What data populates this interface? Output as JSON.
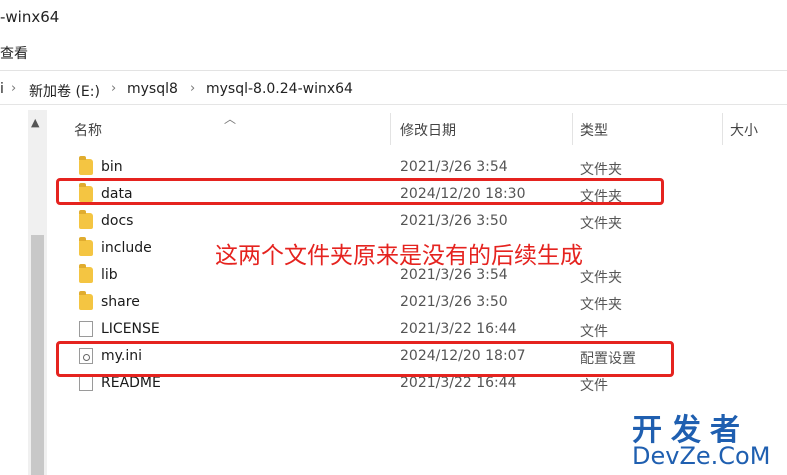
{
  "window": {
    "title": "-winx64"
  },
  "ribbon": {
    "label": "查看"
  },
  "address": {
    "prefix": "i",
    "crumbs": [
      "新加卷 (E:)",
      "mysql8",
      "mysql-8.0.24-winx64"
    ]
  },
  "columns": {
    "name": "名称",
    "date": "修改日期",
    "type": "类型",
    "size": "大小"
  },
  "files": [
    {
      "name": "bin",
      "date": "2021/3/26 3:54",
      "type": "文件夹",
      "icon": "folder-icon"
    },
    {
      "name": "data",
      "date": "2024/12/20 18:30",
      "type": "文件夹",
      "icon": "folder-icon"
    },
    {
      "name": "docs",
      "date": "2021/3/26 3:50",
      "type": "文件夹",
      "icon": "folder-icon"
    },
    {
      "name": "include",
      "date": "",
      "type": "",
      "icon": "folder-icon"
    },
    {
      "name": "lib",
      "date": "2021/3/26 3:54",
      "type": "文件夹",
      "icon": "folder-icon"
    },
    {
      "name": "share",
      "date": "2021/3/26 3:50",
      "type": "文件夹",
      "icon": "folder-icon"
    },
    {
      "name": "LICENSE",
      "date": "2021/3/22 16:44",
      "type": "文件",
      "icon": "file-icon"
    },
    {
      "name": "my.ini",
      "date": "2024/12/20 18:07",
      "type": "配置设置",
      "icon": "config-file-icon"
    },
    {
      "name": "README",
      "date": "2021/3/22 16:44",
      "type": "文件",
      "icon": "file-icon"
    }
  ],
  "annotation": {
    "text": "这两个文件夹原来是没有的后续生成",
    "color": "#e5231f"
  },
  "watermark": {
    "line1": "开发者",
    "line2": "DevZe.CoM",
    "color": "#1f5fb0"
  }
}
